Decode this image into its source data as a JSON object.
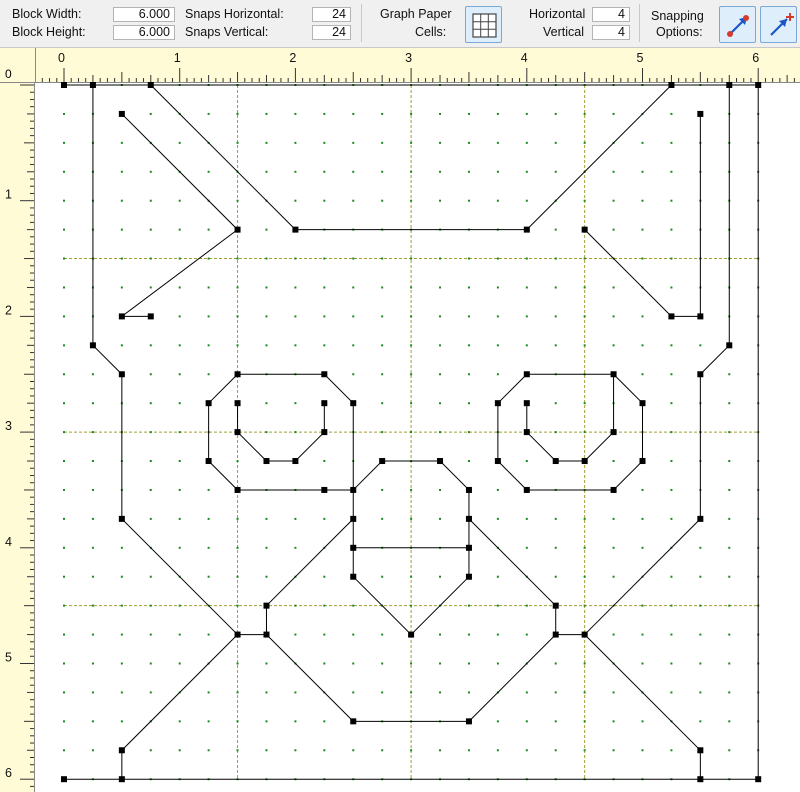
{
  "toolbar": {
    "block_width_label": "Block Width:",
    "block_width_value": "6.000",
    "block_height_label": "Block Height:",
    "block_height_value": "6.000",
    "snaps_horizontal_label": "Snaps Horizontal:",
    "snaps_horizontal_value": "24",
    "snaps_vertical_label": "Snaps Vertical:",
    "snaps_vertical_value": "24",
    "graph_paper_label_1": "Graph Paper",
    "graph_paper_label_2": "Cells:",
    "graph_paper_icon": "grid-icon",
    "horizontal_label": "Horizontal",
    "horizontal_value": "4",
    "vertical_label": "Vertical",
    "vertical_value": "4",
    "snapping_label_1": "Snapping",
    "snapping_label_2": "Options:",
    "snap_button_1_icon": "snap-to-node-icon",
    "snap_button_2_icon": "snap-to-grid-icon"
  },
  "ruler": {
    "corner_label": "0",
    "h_labels": [
      "0",
      "1",
      "2",
      "3",
      "4",
      "5",
      "6"
    ],
    "v_labels": [
      "1",
      "2",
      "3",
      "4",
      "5",
      "6"
    ]
  },
  "colors": {
    "ruler_bg": "#fffbd6",
    "snap_dot": "#1a8a1a",
    "cell_line": "#a0a030",
    "block_line": "#000000"
  }
}
